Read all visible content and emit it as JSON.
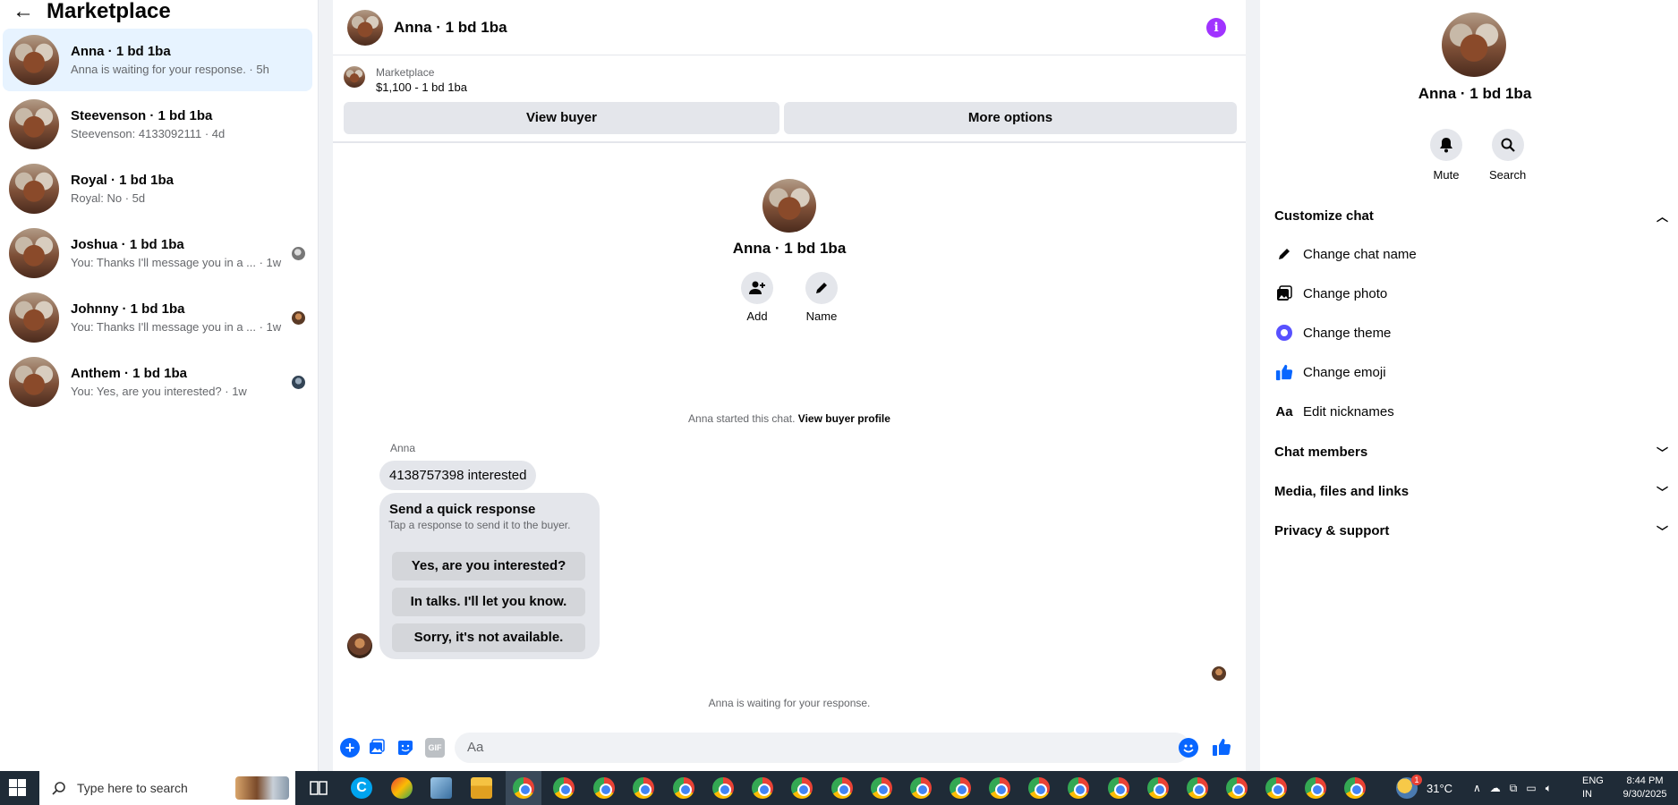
{
  "sidebar": {
    "title": "Marketplace",
    "conversations": [
      {
        "name": "Anna · 1 bd 1ba",
        "preview": "Anna is waiting for your response. · 5h"
      },
      {
        "name": "Steevenson · 1 bd 1ba",
        "preview": "Steevenson: 4133092111 · 4d"
      },
      {
        "name": "Royal · 1 bd 1ba",
        "preview": "Royal: No · 5d"
      },
      {
        "name": "Joshua · 1 bd 1ba",
        "preview": "You: Thanks I'll message you in a ... · 1w"
      },
      {
        "name": "Johnny · 1 bd 1ba",
        "preview": "You: Thanks I'll message you in a ... · 1w"
      },
      {
        "name": "Anthem · 1 bd 1ba",
        "preview": "You: Yes, are you interested? · 1w"
      }
    ]
  },
  "chat": {
    "title": "Anna · 1 bd 1ba",
    "marketplace_label": "Marketplace",
    "listing": "$1,100 - 1 bd 1ba",
    "view_buyer": "View buyer",
    "more_options": "More options",
    "profile_name": "Anna · 1 bd 1ba",
    "add_label": "Add",
    "name_label": "Name",
    "started_text": "Anna started this chat.",
    "view_buyer_profile": "View buyer profile",
    "sender": "Anna",
    "message": "4138757398 interested",
    "quick_title": "Send a quick response",
    "quick_subtitle": "Tap a response to send it to the buyer.",
    "quick_responses": [
      "Yes, are you interested?",
      "In talks. I'll let you know.",
      "Sorry, it's not available."
    ],
    "waiting_text": "Anna is waiting for your response.",
    "composer_placeholder": "Aa",
    "gif_label": "GIF"
  },
  "details": {
    "name": "Anna · 1 bd 1ba",
    "mute": "Mute",
    "search": "Search",
    "customize_chat": "Customize chat",
    "customize_items": [
      "Change chat name",
      "Change photo",
      "Change theme",
      "Change emoji",
      "Edit nicknames"
    ],
    "chat_members": "Chat members",
    "media": "Media, files and links",
    "privacy": "Privacy & support",
    "aa_icon_text": "Aa"
  },
  "taskbar": {
    "search_placeholder": "Type here to search",
    "temperature": "31°C",
    "lang1": "ENG",
    "lang2": "IN",
    "time": "8:44 PM",
    "date": "9/30/2025",
    "weather_badge": "1"
  },
  "colors": {
    "accent": "#0866ff",
    "active_row": "#e7f3ff",
    "info": "#a033ff",
    "taskbar": "#1f2b37"
  }
}
